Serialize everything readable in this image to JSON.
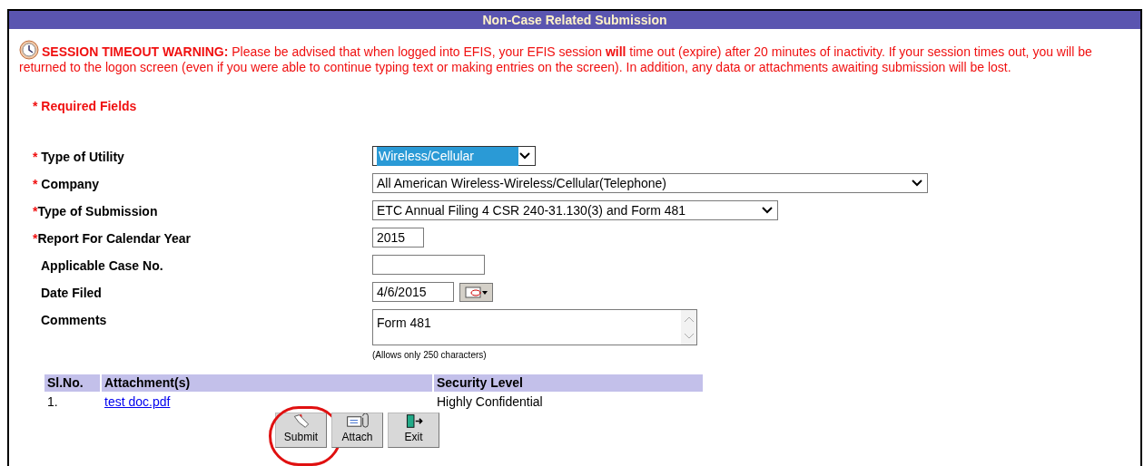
{
  "title": "Non-Case Related Submission",
  "warning": {
    "label": "SESSION TIMEOUT WARNING:",
    "text": "Please be advised that when logged into EFIS, your EFIS session **will** time out (expire) after 20 minutes of inactivity. If your session times out, you will be returned to the logon screen (even if you were able to continue typing text or making entries on the screen). In addition, any data or attachments awaiting submission will be lost."
  },
  "required_note": "* Required Fields",
  "fields": [
    {
      "kind": "select",
      "star": "* ",
      "label": "Type of Utility",
      "value": "Wireless/Cellular",
      "focused": true
    },
    {
      "kind": "select",
      "star": "* ",
      "label": "Company",
      "value": "All American Wireless-Wireless/Cellular(Telephone)",
      "focused": false
    },
    {
      "kind": "select",
      "star": "*",
      "label": "Type of Submission",
      "value": "ETC Annual Filing 4 CSR 240-31.130(3) and Form 481",
      "focused": false
    },
    {
      "kind": "text",
      "star": "*",
      "label": "Report For Calendar Year",
      "value": "2015"
    },
    {
      "kind": "text",
      "label": "Applicable Case No."
    },
    {
      "kind": "date",
      "label": "Date Filed",
      "value": "4/6/2015"
    },
    {
      "kind": "textarea",
      "label": "Comments",
      "value": "Form 481",
      "hint": "(Allows only 250 characters)"
    }
  ],
  "attachments": {
    "columns": [
      "Sl.No.",
      "Attachment(s)",
      "Security Level"
    ],
    "rows": [
      {
        "no": "1.",
        "file": "test doc.pdf",
        "level": "Highly Confidential"
      }
    ]
  },
  "buttons": [
    {
      "kind": "submit",
      "label": "Submit",
      "highlighted": true
    },
    {
      "kind": "attach",
      "label": "Attach",
      "highlighted": false
    },
    {
      "kind": "exit",
      "label": "Exit",
      "highlighted": false
    }
  ]
}
